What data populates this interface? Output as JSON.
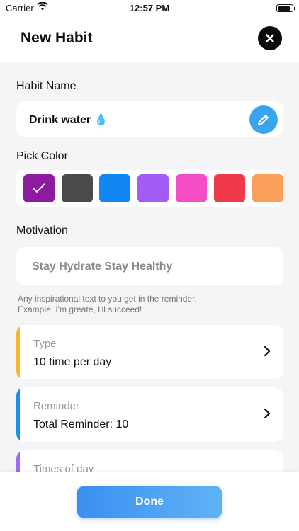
{
  "status_bar": {
    "carrier": "Carrier",
    "time": "12:57 PM",
    "battery_level": 0.9
  },
  "header": {
    "title": "New Habit",
    "close_icon": "close-icon"
  },
  "habit_name": {
    "label": "Habit Name",
    "value": "Drink water 💧",
    "edit_icon": "pencil-icon",
    "edit_button_color": "#3aa5ee"
  },
  "pick_color": {
    "label": "Pick Color",
    "selected_index": 0,
    "check_icon": "checkmark-icon",
    "swatches": [
      "#8e1aa0",
      "#4a4a4a",
      "#1087f5",
      "#a45cf7",
      "#f54ec4",
      "#f03a4a",
      "#fba05a"
    ]
  },
  "motivation": {
    "label": "Motivation",
    "value": "Stay Hydrate Stay Healthy",
    "hint_line1": "Any inspirational text to you get in the reminder.",
    "hint_line2": "Example: I'm greate, I'll succeed!"
  },
  "options": [
    {
      "label": "Type",
      "value": "10 time per day",
      "accent": "#f7b731"
    },
    {
      "label": "Reminder",
      "value": "Total Reminder: 10",
      "accent": "#1a8fe3"
    },
    {
      "label": "Times of day",
      "value": "",
      "accent": "#9b6cf0"
    }
  ],
  "footer": {
    "done_label": "Done"
  }
}
